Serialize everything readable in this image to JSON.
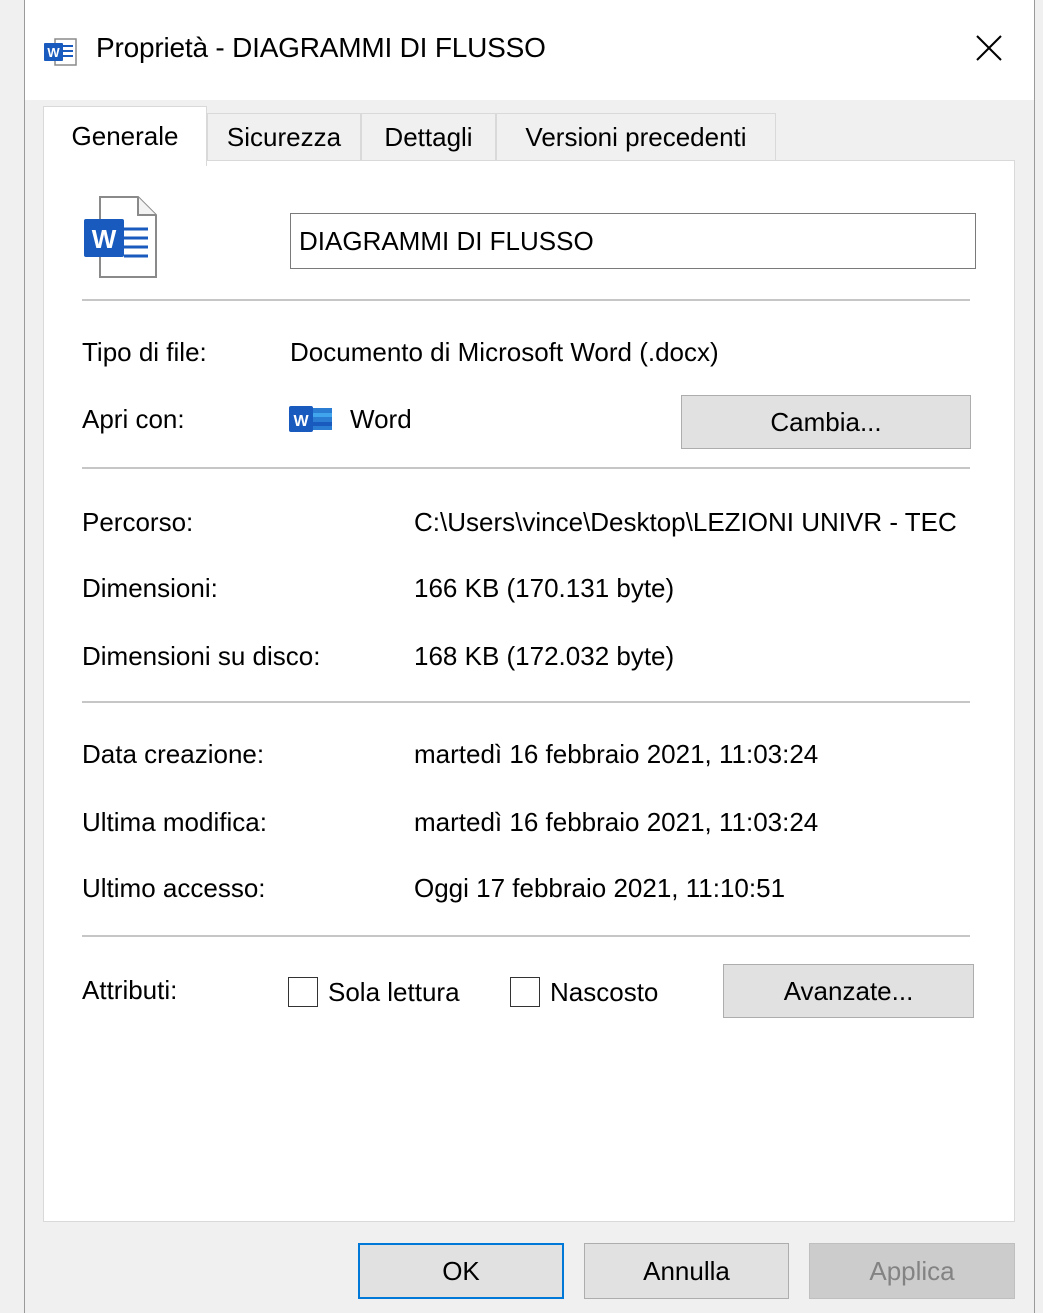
{
  "window": {
    "title": "Proprietà - DIAGRAMMI DI FLUSSO",
    "title_icon": "word-icon",
    "close_icon": "close-icon"
  },
  "tabs": [
    {
      "label": "Generale",
      "active": true
    },
    {
      "label": "Sicurezza",
      "active": false
    },
    {
      "label": "Dettagli",
      "active": false
    },
    {
      "label": "Versioni precedenti",
      "active": false
    }
  ],
  "general": {
    "file_icon": "word-document-icon",
    "file_name_value": "DIAGRAMMI DI FLUSSO",
    "file_type_label": "Tipo di file:",
    "file_type_value": "Documento di Microsoft Word (.docx)",
    "open_with_label": "Apri con:",
    "open_with_app": "Word",
    "change_button": "Cambia...",
    "path_label": "Percorso:",
    "path_value": "C:\\Users\\vince\\Desktop\\LEZIONI UNIVR - TEC",
    "size_label": "Dimensioni:",
    "size_value": "166 KB (170.131 byte)",
    "disk_size_label": "Dimensioni su disco:",
    "disk_size_value": "168 KB (172.032 byte)",
    "created_label": "Data creazione:",
    "created_value": "martedì 16 febbraio 2021, 11:03:24",
    "modified_label": "Ultima modifica:",
    "modified_value": "martedì 16 febbraio 2021, 11:03:24",
    "accessed_label": "Ultimo accesso:",
    "accessed_value": "Oggi 17 febbraio 2021, 11:10:51",
    "attributes_label": "Attributi:",
    "readonly_label": "Sola lettura",
    "readonly_checked": false,
    "hidden_label": "Nascosto",
    "hidden_checked": false,
    "advanced_button": "Avanzate..."
  },
  "footer": {
    "ok_button": "OK",
    "cancel_button": "Annulla",
    "apply_button": "Applica"
  },
  "colors": {
    "word_blue": "#185abd",
    "focus_blue": "#0078d7"
  }
}
